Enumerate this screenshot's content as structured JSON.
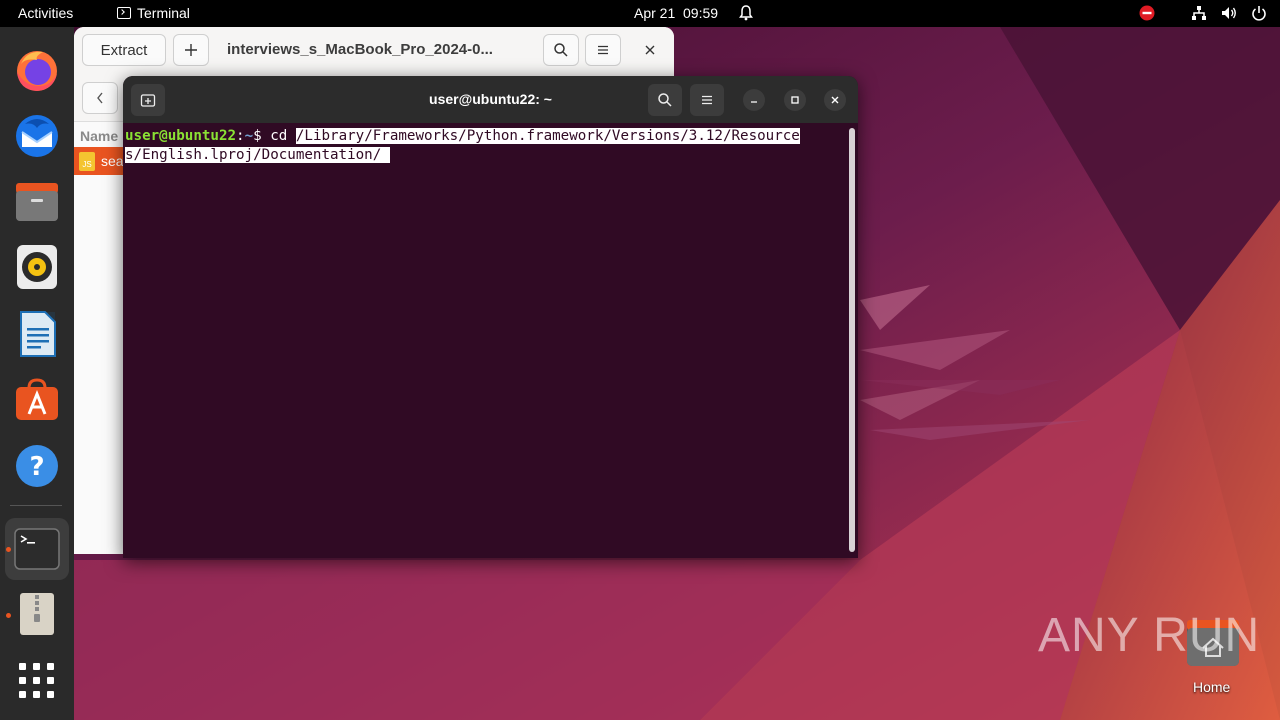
{
  "topbar": {
    "activities": "Activities",
    "app_name": "Terminal",
    "date": "Apr 21",
    "time": "09:59"
  },
  "dock": {
    "items": [
      "firefox",
      "thunderbird",
      "files",
      "rhythmbox",
      "libreoffice-writer",
      "app-center",
      "help",
      "terminal",
      "archive-manager",
      "show-apps"
    ]
  },
  "archive_window": {
    "extract_label": "Extract",
    "title": "interviews_s_MacBook_Pro_2024-0...",
    "column_name": "Name",
    "row_name": "sea",
    "row_icon_text": "JS"
  },
  "terminal": {
    "title": "user@ubuntu22: ~",
    "prompt_user": "user@ubuntu22",
    "prompt_sep": ":",
    "prompt_path": "~",
    "prompt_symbol": "$ ",
    "command": "cd ",
    "line1_selected": "/Library/Frameworks/Python.framework/Versions/3.12/Resource",
    "line2_selected": "s/English.lproj/Documentation/ "
  },
  "desktop": {
    "home_label": "Home",
    "watermark": "ANY RUN"
  }
}
